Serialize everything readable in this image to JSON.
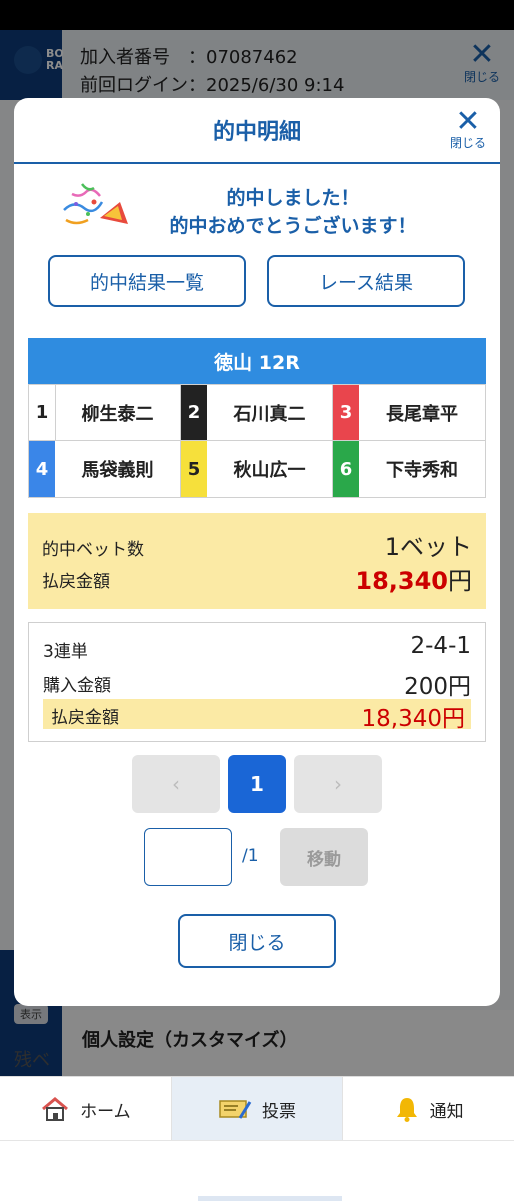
{
  "background": {
    "logo_text": "BO\nRA",
    "member_number_line": "加入者番号　：07087462",
    "last_login_line": "前回ログイン：2025/6/30  9:14",
    "close_label": "閉じる",
    "hyoji_label": "表示",
    "zan_label": "残ベ",
    "personal_settings": "個人設定（カスタマイズ）"
  },
  "modal": {
    "title": "的中明細",
    "close_label": "閉じる",
    "congrats_line1": "的中しました！",
    "congrats_line2": "的中おめでとうございます！",
    "buttons": {
      "results_list": "的中結果一覧",
      "race_results": "レース結果"
    },
    "race": {
      "venue_race": "徳山  12R",
      "racers": [
        {
          "num": "1",
          "name": "柳生泰二",
          "color": "#ffffff",
          "text_color": "#222222"
        },
        {
          "num": "2",
          "name": "石川真二",
          "color": "#222222",
          "text_color": "#ffffff"
        },
        {
          "num": "3",
          "name": "長尾章平",
          "color": "#e9454d",
          "text_color": "#ffffff"
        },
        {
          "num": "4",
          "name": "馬袋義則",
          "color": "#3a86e8",
          "text_color": "#ffffff"
        },
        {
          "num": "5",
          "name": "秋山広一",
          "color": "#f6e03b",
          "text_color": "#222222"
        },
        {
          "num": "6",
          "name": "下寺秀和",
          "color": "#2aa84a",
          "text_color": "#ffffff"
        }
      ]
    },
    "summary": {
      "hit_bets_label": "的中ベット数",
      "hit_bets_value": "1ベット",
      "payout_label": "払戻金額",
      "payout_amount": "18,340",
      "payout_unit": "円"
    },
    "bet": {
      "type_label": "3連単",
      "combination": "2-4-1",
      "purchase_label": "購入金額",
      "purchase_value": "200円",
      "payout_label": "払戻金額",
      "payout_value": "18,340円"
    },
    "pager": {
      "prev": "‹",
      "current": "1",
      "next": "›",
      "input_value": "",
      "total": "/1",
      "move_label": "移動"
    },
    "close_button": "閉じる"
  },
  "bottom_nav": {
    "home": "ホーム",
    "vote": "投票",
    "notify": "通知",
    "active": "vote"
  },
  "colors": {
    "primary": "#1a5fa8",
    "race_bar": "#2f8ce0",
    "highlight": "#fbeaa5",
    "payout_red": "#cc0000",
    "pager_active": "#1a66d6"
  }
}
